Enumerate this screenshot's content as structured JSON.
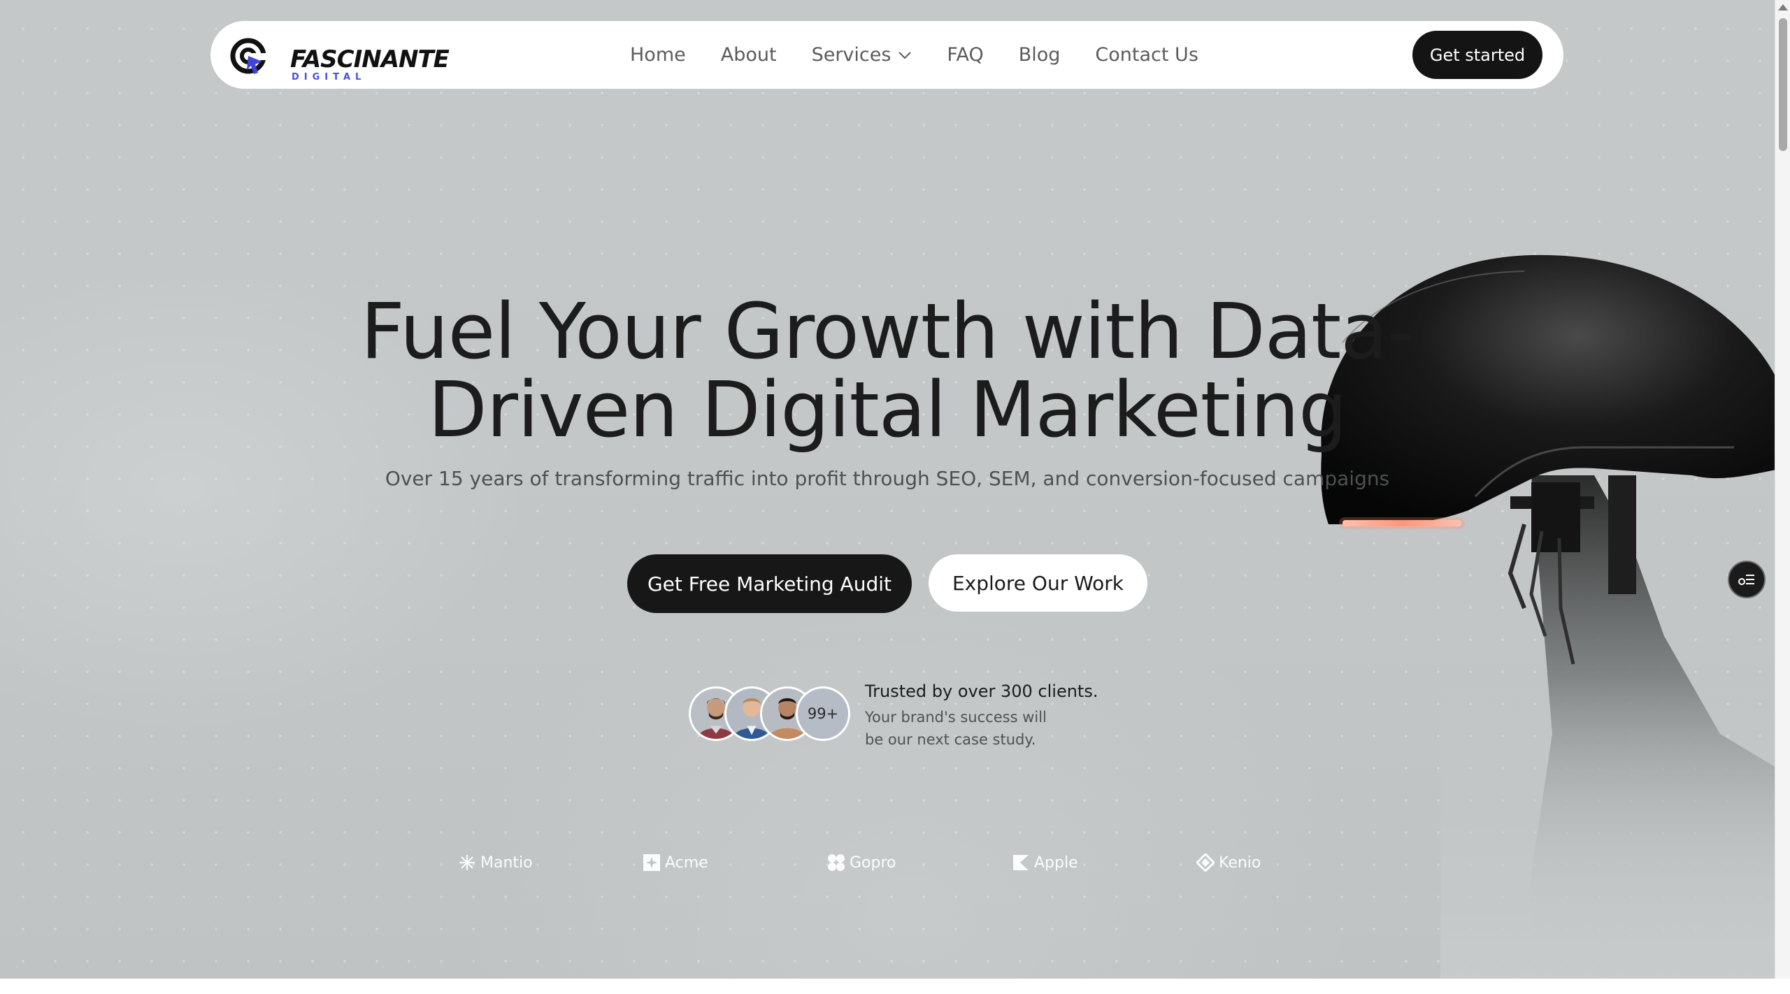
{
  "brand": {
    "name": "FASCINANTE",
    "tagline": "DIGITAL",
    "accent_color": "#4a4fd8"
  },
  "nav": {
    "items": [
      {
        "label": "Home"
      },
      {
        "label": "About"
      },
      {
        "label": "Services",
        "has_dropdown": true
      },
      {
        "label": "FAQ"
      },
      {
        "label": "Blog"
      },
      {
        "label": "Contact Us"
      }
    ],
    "cta_label": "Get started"
  },
  "hero": {
    "title_line1": "Fuel Your Growth with Data-",
    "title_line2": "Driven Digital Marketing",
    "subtitle": "Over 15 years of transforming traffic into profit through SEO, SEM, and conversion-focused campaigns",
    "primary_cta": "Get Free Marketing Audit",
    "secondary_cta": "Explore Our Work"
  },
  "trust": {
    "count_badge": "99+",
    "title": "Trusted by over 300 clients.",
    "body": "Your brand's success will be our next case study."
  },
  "logos": [
    {
      "name": "Mantio",
      "icon": "burst-icon"
    },
    {
      "name": "Acme",
      "icon": "square-cross-icon"
    },
    {
      "name": "Gopro",
      "icon": "four-petal-icon"
    },
    {
      "name": "Apple",
      "icon": "k-mark-icon"
    },
    {
      "name": "Kenio",
      "icon": "diamond-loop-icon"
    }
  ],
  "colors": {
    "background": "#c4c8c8",
    "dark_button": "#171717",
    "robot_light": "#f0a08a"
  }
}
